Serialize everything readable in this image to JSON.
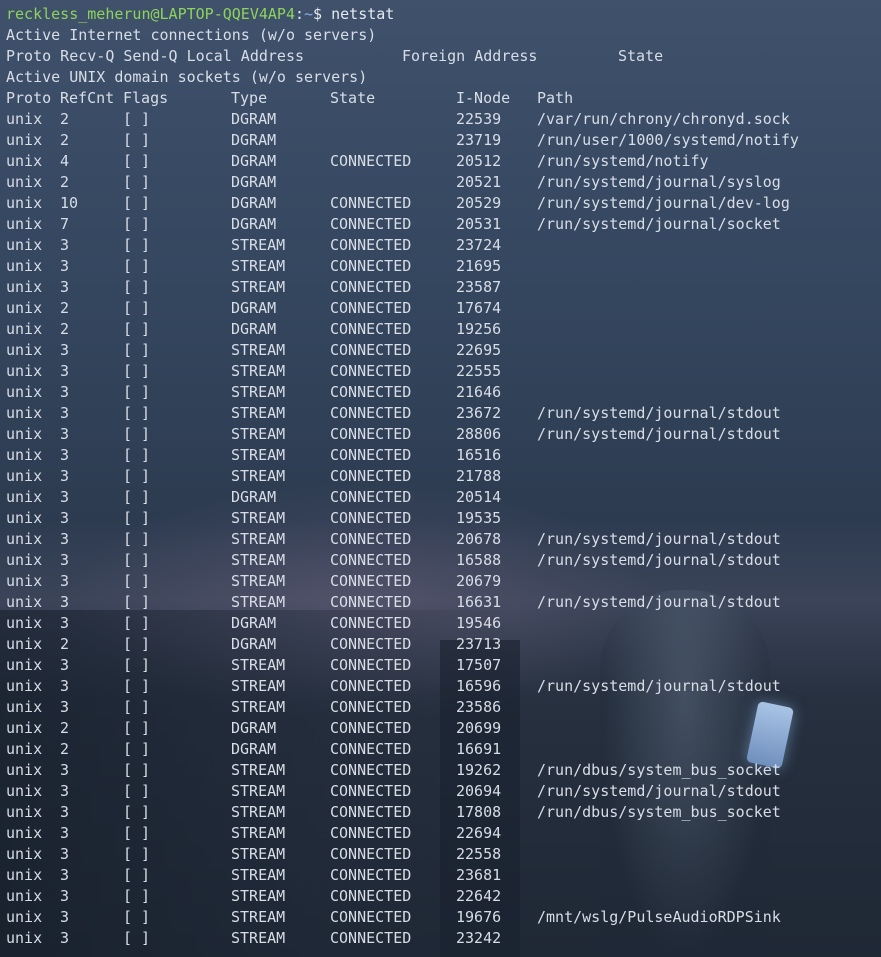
{
  "prompt": {
    "user_host": "reckless_meherun@LAPTOP-QQEV4AP4",
    "separator": ":",
    "cwd": "~",
    "symbol": "$",
    "command": "netstat"
  },
  "internet_section": {
    "title": "Active Internet connections (w/o servers)",
    "headers": {
      "left": "Proto Recv-Q Send-Q Local Address",
      "foreign": "Foreign Address",
      "state": "State"
    }
  },
  "unix_section": {
    "title": "Active UNIX domain sockets (w/o servers)",
    "headers": {
      "proto": "Proto",
      "refcnt": "RefCnt",
      "flags": "Flags",
      "type": "Type",
      "state": "State",
      "inode": "I-Node",
      "path": "Path"
    },
    "rows": [
      {
        "proto": "unix",
        "refcnt": "2",
        "flags": "[ ]",
        "type": "DGRAM",
        "state": "",
        "inode": "22539",
        "path": "/var/run/chrony/chronyd.sock"
      },
      {
        "proto": "unix",
        "refcnt": "2",
        "flags": "[ ]",
        "type": "DGRAM",
        "state": "",
        "inode": "23719",
        "path": "/run/user/1000/systemd/notify"
      },
      {
        "proto": "unix",
        "refcnt": "4",
        "flags": "[ ]",
        "type": "DGRAM",
        "state": "CONNECTED",
        "inode": "20512",
        "path": "/run/systemd/notify"
      },
      {
        "proto": "unix",
        "refcnt": "2",
        "flags": "[ ]",
        "type": "DGRAM",
        "state": "",
        "inode": "20521",
        "path": "/run/systemd/journal/syslog"
      },
      {
        "proto": "unix",
        "refcnt": "10",
        "flags": "[ ]",
        "type": "DGRAM",
        "state": "CONNECTED",
        "inode": "20529",
        "path": "/run/systemd/journal/dev-log"
      },
      {
        "proto": "unix",
        "refcnt": "7",
        "flags": "[ ]",
        "type": "DGRAM",
        "state": "CONNECTED",
        "inode": "20531",
        "path": "/run/systemd/journal/socket"
      },
      {
        "proto": "unix",
        "refcnt": "3",
        "flags": "[ ]",
        "type": "STREAM",
        "state": "CONNECTED",
        "inode": "23724",
        "path": ""
      },
      {
        "proto": "unix",
        "refcnt": "3",
        "flags": "[ ]",
        "type": "STREAM",
        "state": "CONNECTED",
        "inode": "21695",
        "path": ""
      },
      {
        "proto": "unix",
        "refcnt": "3",
        "flags": "[ ]",
        "type": "STREAM",
        "state": "CONNECTED",
        "inode": "23587",
        "path": ""
      },
      {
        "proto": "unix",
        "refcnt": "2",
        "flags": "[ ]",
        "type": "DGRAM",
        "state": "CONNECTED",
        "inode": "17674",
        "path": ""
      },
      {
        "proto": "unix",
        "refcnt": "2",
        "flags": "[ ]",
        "type": "DGRAM",
        "state": "CONNECTED",
        "inode": "19256",
        "path": ""
      },
      {
        "proto": "unix",
        "refcnt": "3",
        "flags": "[ ]",
        "type": "STREAM",
        "state": "CONNECTED",
        "inode": "22695",
        "path": ""
      },
      {
        "proto": "unix",
        "refcnt": "3",
        "flags": "[ ]",
        "type": "STREAM",
        "state": "CONNECTED",
        "inode": "22555",
        "path": ""
      },
      {
        "proto": "unix",
        "refcnt": "3",
        "flags": "[ ]",
        "type": "STREAM",
        "state": "CONNECTED",
        "inode": "21646",
        "path": ""
      },
      {
        "proto": "unix",
        "refcnt": "3",
        "flags": "[ ]",
        "type": "STREAM",
        "state": "CONNECTED",
        "inode": "23672",
        "path": "/run/systemd/journal/stdout"
      },
      {
        "proto": "unix",
        "refcnt": "3",
        "flags": "[ ]",
        "type": "STREAM",
        "state": "CONNECTED",
        "inode": "28806",
        "path": "/run/systemd/journal/stdout"
      },
      {
        "proto": "unix",
        "refcnt": "3",
        "flags": "[ ]",
        "type": "STREAM",
        "state": "CONNECTED",
        "inode": "16516",
        "path": ""
      },
      {
        "proto": "unix",
        "refcnt": "3",
        "flags": "[ ]",
        "type": "STREAM",
        "state": "CONNECTED",
        "inode": "21788",
        "path": ""
      },
      {
        "proto": "unix",
        "refcnt": "3",
        "flags": "[ ]",
        "type": "DGRAM",
        "state": "CONNECTED",
        "inode": "20514",
        "path": ""
      },
      {
        "proto": "unix",
        "refcnt": "3",
        "flags": "[ ]",
        "type": "STREAM",
        "state": "CONNECTED",
        "inode": "19535",
        "path": ""
      },
      {
        "proto": "unix",
        "refcnt": "3",
        "flags": "[ ]",
        "type": "STREAM",
        "state": "CONNECTED",
        "inode": "20678",
        "path": "/run/systemd/journal/stdout"
      },
      {
        "proto": "unix",
        "refcnt": "3",
        "flags": "[ ]",
        "type": "STREAM",
        "state": "CONNECTED",
        "inode": "16588",
        "path": "/run/systemd/journal/stdout"
      },
      {
        "proto": "unix",
        "refcnt": "3",
        "flags": "[ ]",
        "type": "STREAM",
        "state": "CONNECTED",
        "inode": "20679",
        "path": ""
      },
      {
        "proto": "unix",
        "refcnt": "3",
        "flags": "[ ]",
        "type": "STREAM",
        "state": "CONNECTED",
        "inode": "16631",
        "path": "/run/systemd/journal/stdout"
      },
      {
        "proto": "unix",
        "refcnt": "3",
        "flags": "[ ]",
        "type": "DGRAM",
        "state": "CONNECTED",
        "inode": "19546",
        "path": ""
      },
      {
        "proto": "unix",
        "refcnt": "2",
        "flags": "[ ]",
        "type": "DGRAM",
        "state": "CONNECTED",
        "inode": "23713",
        "path": ""
      },
      {
        "proto": "unix",
        "refcnt": "3",
        "flags": "[ ]",
        "type": "STREAM",
        "state": "CONNECTED",
        "inode": "17507",
        "path": ""
      },
      {
        "proto": "unix",
        "refcnt": "3",
        "flags": "[ ]",
        "type": "STREAM",
        "state": "CONNECTED",
        "inode": "16596",
        "path": "/run/systemd/journal/stdout"
      },
      {
        "proto": "unix",
        "refcnt": "3",
        "flags": "[ ]",
        "type": "STREAM",
        "state": "CONNECTED",
        "inode": "23586",
        "path": ""
      },
      {
        "proto": "unix",
        "refcnt": "2",
        "flags": "[ ]",
        "type": "DGRAM",
        "state": "CONNECTED",
        "inode": "20699",
        "path": ""
      },
      {
        "proto": "unix",
        "refcnt": "2",
        "flags": "[ ]",
        "type": "DGRAM",
        "state": "CONNECTED",
        "inode": "16691",
        "path": ""
      },
      {
        "proto": "unix",
        "refcnt": "3",
        "flags": "[ ]",
        "type": "STREAM",
        "state": "CONNECTED",
        "inode": "19262",
        "path": "/run/dbus/system_bus_socket"
      },
      {
        "proto": "unix",
        "refcnt": "3",
        "flags": "[ ]",
        "type": "STREAM",
        "state": "CONNECTED",
        "inode": "20694",
        "path": "/run/systemd/journal/stdout"
      },
      {
        "proto": "unix",
        "refcnt": "3",
        "flags": "[ ]",
        "type": "STREAM",
        "state": "CONNECTED",
        "inode": "17808",
        "path": "/run/dbus/system_bus_socket"
      },
      {
        "proto": "unix",
        "refcnt": "3",
        "flags": "[ ]",
        "type": "STREAM",
        "state": "CONNECTED",
        "inode": "22694",
        "path": ""
      },
      {
        "proto": "unix",
        "refcnt": "3",
        "flags": "[ ]",
        "type": "STREAM",
        "state": "CONNECTED",
        "inode": "22558",
        "path": ""
      },
      {
        "proto": "unix",
        "refcnt": "3",
        "flags": "[ ]",
        "type": "STREAM",
        "state": "CONNECTED",
        "inode": "23681",
        "path": ""
      },
      {
        "proto": "unix",
        "refcnt": "3",
        "flags": "[ ]",
        "type": "STREAM",
        "state": "CONNECTED",
        "inode": "22642",
        "path": ""
      },
      {
        "proto": "unix",
        "refcnt": "3",
        "flags": "[ ]",
        "type": "STREAM",
        "state": "CONNECTED",
        "inode": "19676",
        "path": "/mnt/wslg/PulseAudioRDPSink"
      },
      {
        "proto": "unix",
        "refcnt": "3",
        "flags": "[ ]",
        "type": "STREAM",
        "state": "CONNECTED",
        "inode": "23242",
        "path": ""
      }
    ]
  }
}
